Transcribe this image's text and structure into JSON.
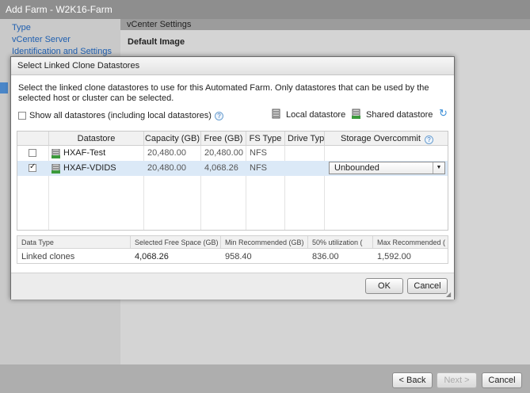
{
  "wizard": {
    "title": "Add Farm - W2K16-Farm",
    "nav": [
      "Type",
      "vCenter Server",
      "Identification and Settings"
    ],
    "section_header": "vCenter Settings",
    "section_title": "Default Image",
    "footer": {
      "back": "< Back",
      "next": "Next >",
      "cancel": "Cancel"
    }
  },
  "dialog": {
    "title": "Select Linked Clone Datastores",
    "description": "Select the linked clone datastores to use for this Automated Farm. Only datastores that can be used by the selected host or cluster can be selected.",
    "show_all_label": "Show all datastores (including local datastores)",
    "show_all_checked": false,
    "legend": {
      "local": "Local datastore",
      "shared": "Shared datastore"
    },
    "table": {
      "columns": [
        "Datastore",
        "Capacity (GB)",
        "Free (GB)",
        "FS Type",
        "Drive Typ",
        "Storage Overcommit"
      ],
      "rows": [
        {
          "checked": false,
          "name": "HXAF-Test",
          "capacity": "20,480.00",
          "free": "20,480.00",
          "fs": "NFS",
          "drive": "",
          "overcommit": ""
        },
        {
          "checked": true,
          "name": "HXAF-VDIDS",
          "capacity": "20,480.00",
          "free": "4,068.26",
          "fs": "NFS",
          "drive": "",
          "overcommit": "Unbounded"
        }
      ]
    },
    "summary": {
      "headers": [
        "Data Type",
        "Selected Free Space (GB)",
        "Min Recommended (GB)",
        "50% utilization (",
        "Max Recommended ("
      ],
      "values": [
        "Linked clones",
        "4,068.26",
        "958.40",
        "836.00",
        "1,592.00"
      ]
    },
    "ok": "OK",
    "cancel": "Cancel"
  },
  "colors": {
    "link": "#1f5fb0",
    "selected_row": "#dbe9f7"
  }
}
